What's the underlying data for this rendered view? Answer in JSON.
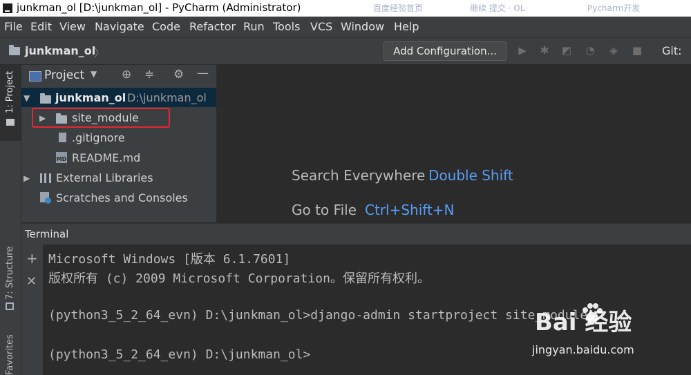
{
  "window": {
    "title": "junkman_ol [D:\\junkman_ol] - PyCharm (Administrator)",
    "ghost_tabs": [
      "百度经验首页",
      "继续 提交 · OL",
      "Pycharm开发"
    ]
  },
  "menu": [
    "File",
    "Edit",
    "View",
    "Navigate",
    "Code",
    "Refactor",
    "Run",
    "Tools",
    "VCS",
    "Window",
    "Help"
  ],
  "navbar": {
    "project_name": "junkman_ol",
    "add_configuration": "Add Configuration...",
    "git_label": "Git:"
  },
  "sidebar": {
    "tabs": [
      "1: Project",
      "7: Structure",
      "Favorites"
    ]
  },
  "project_panel": {
    "title": "Project",
    "tree": {
      "root_name": "junkman_ol",
      "root_path": "D:\\junkman_ol",
      "items": [
        {
          "label": "site_module"
        },
        {
          "label": ".gitignore"
        },
        {
          "label": "README.md",
          "icon_text": "MD"
        },
        {
          "label": "External Libraries"
        },
        {
          "label": "Scratches and Consoles"
        }
      ]
    }
  },
  "editor": {
    "hints": [
      {
        "label": "Search Everywhere",
        "key": "Double Shift"
      },
      {
        "label": "Go to File",
        "key": "Ctrl+Shift+N"
      }
    ]
  },
  "terminal": {
    "title": "Terminal",
    "lines": [
      "Microsoft Windows [版本 6.1.7601]",
      "版权所有 (c) 2009 Microsoft Corporation。保留所有权利。",
      "(python3_5_2_64_evn) D:\\junkman_ol>django-admin startproject site_module",
      "(python3_5_2_64_evn) D:\\junkman_ol>"
    ]
  },
  "watermark": {
    "brand": "Bai  经验",
    "url": "jingyan.baidu.com"
  },
  "colors": {
    "accent_blue": "#589df6",
    "highlight_red": "#e8262f",
    "selection": "#0d293e"
  }
}
